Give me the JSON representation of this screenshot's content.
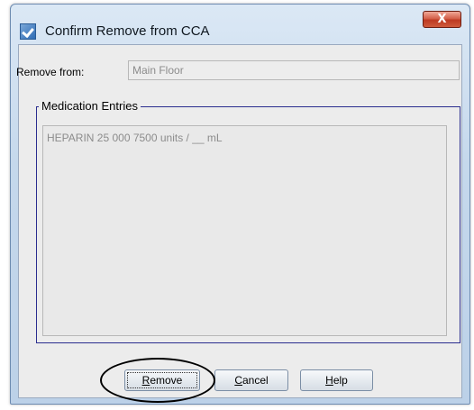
{
  "window": {
    "title": "Confirm Remove from CCA",
    "close_glyph": "X",
    "icon": "checkmark-app-icon"
  },
  "remove_from": {
    "label": "Remove from:",
    "value": "Main Floor"
  },
  "medication_entries": {
    "legend": "Medication Entries",
    "items": [
      "HEPARIN 25 000 7500 units / __ mL"
    ]
  },
  "buttons": {
    "remove": {
      "mnemonic": "R",
      "rest": "emove"
    },
    "cancel": {
      "mnemonic": "C",
      "rest": "ancel"
    },
    "help": {
      "mnemonic": "H",
      "rest": "elp"
    }
  },
  "annotation": {
    "highlight_color": "#000000",
    "highlighted": "remove"
  }
}
